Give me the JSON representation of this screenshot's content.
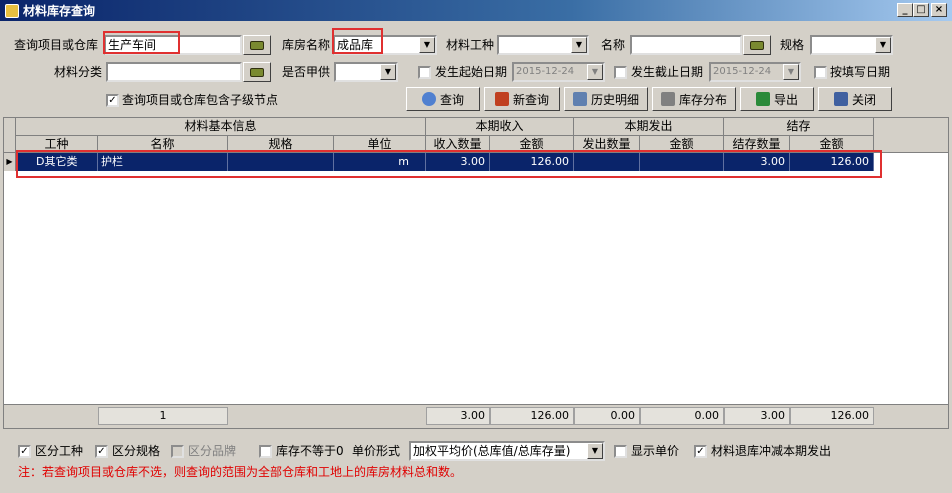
{
  "window": {
    "title": "材料库存查询",
    "minimize": "_",
    "maximize": "□",
    "close": "×"
  },
  "filters": {
    "project_label": "查询项目或仓库",
    "project_value": "生产车间",
    "warehouse_label": "库房名称",
    "warehouse_value": "成品库",
    "material_type_label": "材料工种",
    "material_type_value": "",
    "name_label": "名称",
    "name_value": "",
    "spec_label": "规格",
    "spec_value": "",
    "category_label": "材料分类",
    "category_value": "",
    "supplied_label": "是否甲供",
    "supplied_value": "",
    "start_date_label": "发生起始日期",
    "start_date_value": "2015-12-24",
    "end_date_label": "发生截止日期",
    "end_date_value": "2015-12-24",
    "fill_date_label": "按填写日期",
    "include_children_label": "查询项目或仓库包含子级节点"
  },
  "toolbar": {
    "query": "查询",
    "new_query": "新查询",
    "history": "历史明细",
    "distribution": "库存分布",
    "export": "导出",
    "close": "关闭"
  },
  "grid": {
    "group_headers": [
      "材料基本信息",
      "本期收入",
      "本期发出",
      "结存"
    ],
    "columns": [
      "工种",
      "名称",
      "规格",
      "单位",
      "收入数量",
      "金额",
      "发出数量",
      "金额",
      "结存数量",
      "金额"
    ],
    "rows": [
      [
        "D其它类",
        "护栏",
        "",
        "m",
        "3.00",
        "126.00",
        "",
        "",
        "3.00",
        "126.00"
      ]
    ],
    "footer": [
      "1",
      "3.00",
      "126.00",
      "0.00",
      "0.00",
      "3.00",
      "126.00"
    ]
  },
  "options": {
    "by_type_label": "区分工种",
    "by_spec_label": "区分规格",
    "by_brand_label": "区分品牌",
    "stock_nonzero_label": "库存不等于0",
    "price_form_label": "单价形式",
    "price_form_value": "加权平均价(总库值/总库存量)",
    "show_price_label": "显示单价",
    "return_offset_label": "材料退库冲减本期发出"
  },
  "notice": "注：若查询项目或仓库不选，则查询的范围为全部仓库和工地上的库房材料总和数。"
}
